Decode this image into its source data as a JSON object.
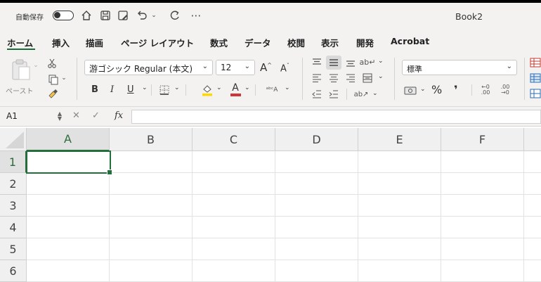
{
  "titlebar": {
    "autosave_label": "自動保存",
    "doc_title": "Book2",
    "icons": [
      "home-icon",
      "save-icon",
      "edit-save-icon",
      "undo-icon",
      "chevron-down-icon",
      "redo-icon",
      "more-icon"
    ]
  },
  "tabs": [
    {
      "label": "ホーム",
      "active": true
    },
    {
      "label": "挿入"
    },
    {
      "label": "描画"
    },
    {
      "label": "ページ レイアウト"
    },
    {
      "label": "数式"
    },
    {
      "label": "データ"
    },
    {
      "label": "校閲"
    },
    {
      "label": "表示"
    },
    {
      "label": "開発"
    },
    {
      "label": "Acrobat"
    }
  ],
  "ribbon": {
    "paste_label": "ペースト",
    "font_name": "游ゴシック Regular (本文)",
    "font_size": "12",
    "number_format": "標準",
    "bold": "B",
    "italic": "I",
    "underline": "U",
    "grow_font": "A",
    "shrink_font": "A",
    "font_color_letter": "A",
    "percent": "%",
    "comma": "❜",
    "font_color": "#d13438",
    "highlight_color": "#ffd800"
  },
  "formula_bar": {
    "name_box": "A1",
    "fx_label": "fx",
    "formula": ""
  },
  "grid": {
    "columns": [
      "A",
      "B",
      "C",
      "D",
      "E",
      "F"
    ],
    "rows": [
      "1",
      "2",
      "3",
      "4",
      "5",
      "6"
    ],
    "selected_cell": "A1",
    "accent": "#21703a"
  }
}
